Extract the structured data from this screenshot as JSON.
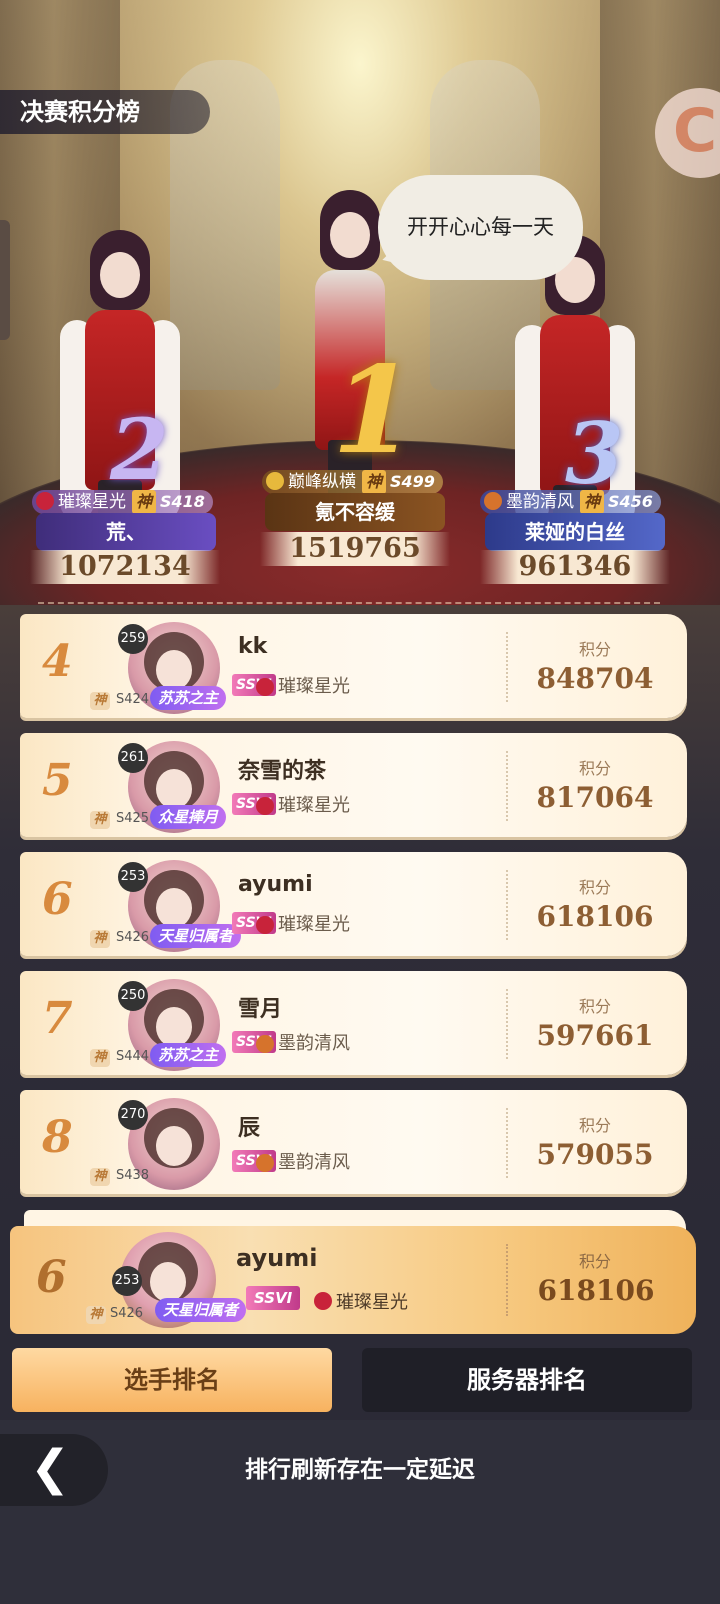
{
  "header": {
    "title": "决赛积分榜"
  },
  "bubble_text": "开开心心每一天",
  "podium": [
    {
      "rank": "2",
      "server": "璀璨星光",
      "god": "神",
      "season": "S418",
      "name": "荒、",
      "score": "1072134"
    },
    {
      "rank": "1",
      "server": "巅峰纵横",
      "god": "神",
      "season": "S499",
      "name": "氪不容缓",
      "score": "1519765"
    },
    {
      "rank": "3",
      "server": "墨韵清风",
      "god": "神",
      "season": "S456",
      "name": "莱娅的白丝",
      "score": "961346"
    }
  ],
  "score_label": "积分",
  "rows": [
    {
      "rank": "4",
      "level": "259",
      "god": "神",
      "season": "S424",
      "frame": "苏苏之主",
      "name": "kk",
      "badge": "SSVI",
      "server": "璀璨星光",
      "score": "848704"
    },
    {
      "rank": "5",
      "level": "261",
      "god": "神",
      "season": "S425",
      "frame": "众星捧月",
      "name": "奈雪的茶",
      "badge": "SSVI",
      "server": "璀璨星光",
      "score": "817064"
    },
    {
      "rank": "6",
      "level": "253",
      "god": "神",
      "season": "S426",
      "frame": "天星归属者",
      "name": "ayumi",
      "badge": "SSVI",
      "server": "璀璨星光",
      "score": "618106"
    },
    {
      "rank": "7",
      "level": "250",
      "god": "神",
      "season": "S444",
      "frame": "苏苏之主",
      "name": "雪月",
      "badge": "SSVI",
      "server": "墨韵清风",
      "score": "597661"
    },
    {
      "rank": "8",
      "level": "270",
      "god": "神",
      "season": "S438",
      "frame": "",
      "name": "辰",
      "badge": "SSVI",
      "server": "墨韵清风",
      "score": "579055"
    }
  ],
  "my_row": {
    "rank": "6",
    "level": "253",
    "god": "神",
    "season": "S426",
    "frame": "天星归属者",
    "name": "ayumi",
    "badge": "SSVI",
    "server": "璀璨星光",
    "score": "618106"
  },
  "tabs": {
    "player": "选手排名",
    "server": "服务器排名"
  },
  "footer": {
    "notice": "排行刷新存在一定延迟"
  },
  "colors": {
    "server_red": "#c8233a",
    "server_orange": "#d6732c",
    "accent_gold": "#d88a3e"
  }
}
